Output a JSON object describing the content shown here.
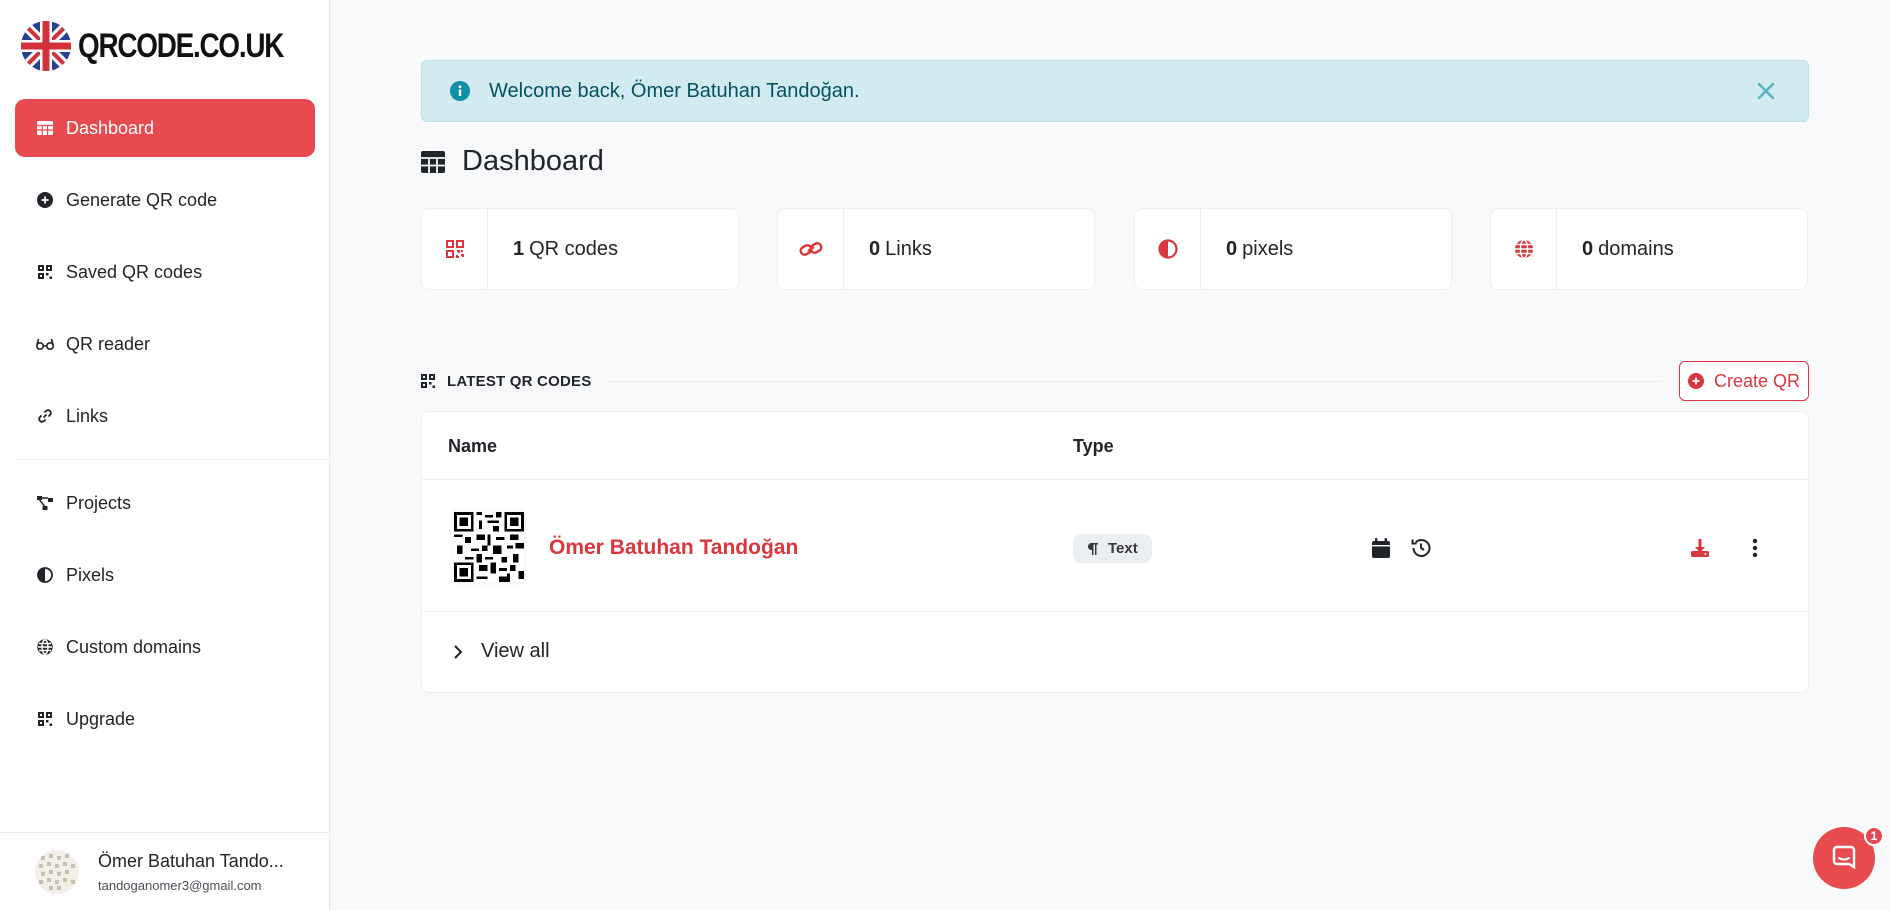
{
  "brand": {
    "name": "QRCODE.CO.UK",
    "accent": "#e84b4f"
  },
  "sidebar": {
    "items": [
      {
        "label": "Dashboard",
        "icon": "table-icon",
        "active": true
      },
      {
        "label": "Generate QR code",
        "icon": "plus-circle-icon"
      },
      {
        "label": "Saved QR codes",
        "icon": "qrcode-icon"
      },
      {
        "label": "QR reader",
        "icon": "glasses-icon"
      },
      {
        "label": "Links",
        "icon": "link-icon"
      },
      {
        "label": "Projects",
        "icon": "project-diagram-icon"
      },
      {
        "label": "Pixels",
        "icon": "adjust-icon"
      },
      {
        "label": "Custom domains",
        "icon": "globe-icon"
      },
      {
        "label": "Upgrade",
        "icon": "qrcode-icon"
      }
    ],
    "user": {
      "name": "Ömer Batuhan Tando...",
      "email": "tandoganomer3@gmail.com"
    }
  },
  "alert": {
    "text": "Welcome back, Ömer Batuhan Tandoğan."
  },
  "page": {
    "title": "Dashboard"
  },
  "stats": [
    {
      "value": "1",
      "label": "QR codes",
      "icon": "qrcode-icon"
    },
    {
      "value": "0",
      "label": "Links",
      "icon": "link-icon"
    },
    {
      "value": "0",
      "label": "pixels",
      "icon": "adjust-icon"
    },
    {
      "value": "0",
      "label": "domains",
      "icon": "globe-icon"
    }
  ],
  "latest": {
    "title": "LATEST QR CODES",
    "create_label": "Create QR",
    "columns": [
      "Name",
      "Type"
    ],
    "rows": [
      {
        "name": "Ömer Batuhan Tandoğan",
        "type": "Text"
      }
    ],
    "view_all": "View all"
  },
  "chat": {
    "badge": "1"
  }
}
